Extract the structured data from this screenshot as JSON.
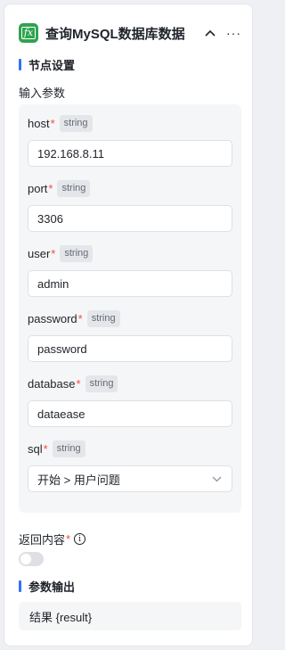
{
  "header": {
    "icon": "function-icon",
    "icon_text": "fx",
    "title": "查询MySQL数据库数据",
    "collapse_icon": "chevron-up-icon",
    "more_icon": "more-icon",
    "more_text": "···"
  },
  "node_settings": {
    "title": "节点设置"
  },
  "inputs": {
    "title": "输入参数",
    "required_mark": "*",
    "fields": [
      {
        "label": "host",
        "type": "string",
        "value": "192.168.8.11"
      },
      {
        "label": "port",
        "type": "string",
        "value": "3306"
      },
      {
        "label": "user",
        "type": "string",
        "value": "admin"
      },
      {
        "label": "password",
        "type": "string",
        "value": "password"
      },
      {
        "label": "database",
        "type": "string",
        "value": "dataease"
      },
      {
        "label": "sql",
        "type": "string",
        "value": "开始 > 用户问题"
      }
    ]
  },
  "return_content": {
    "label": "返回内容",
    "info_text": "i",
    "enabled": false
  },
  "output": {
    "title": "参数输出",
    "value": "结果 {result}"
  },
  "colors": {
    "accent": "#3370ff",
    "icon_bg": "#2ea44f",
    "required": "#f54a45"
  }
}
